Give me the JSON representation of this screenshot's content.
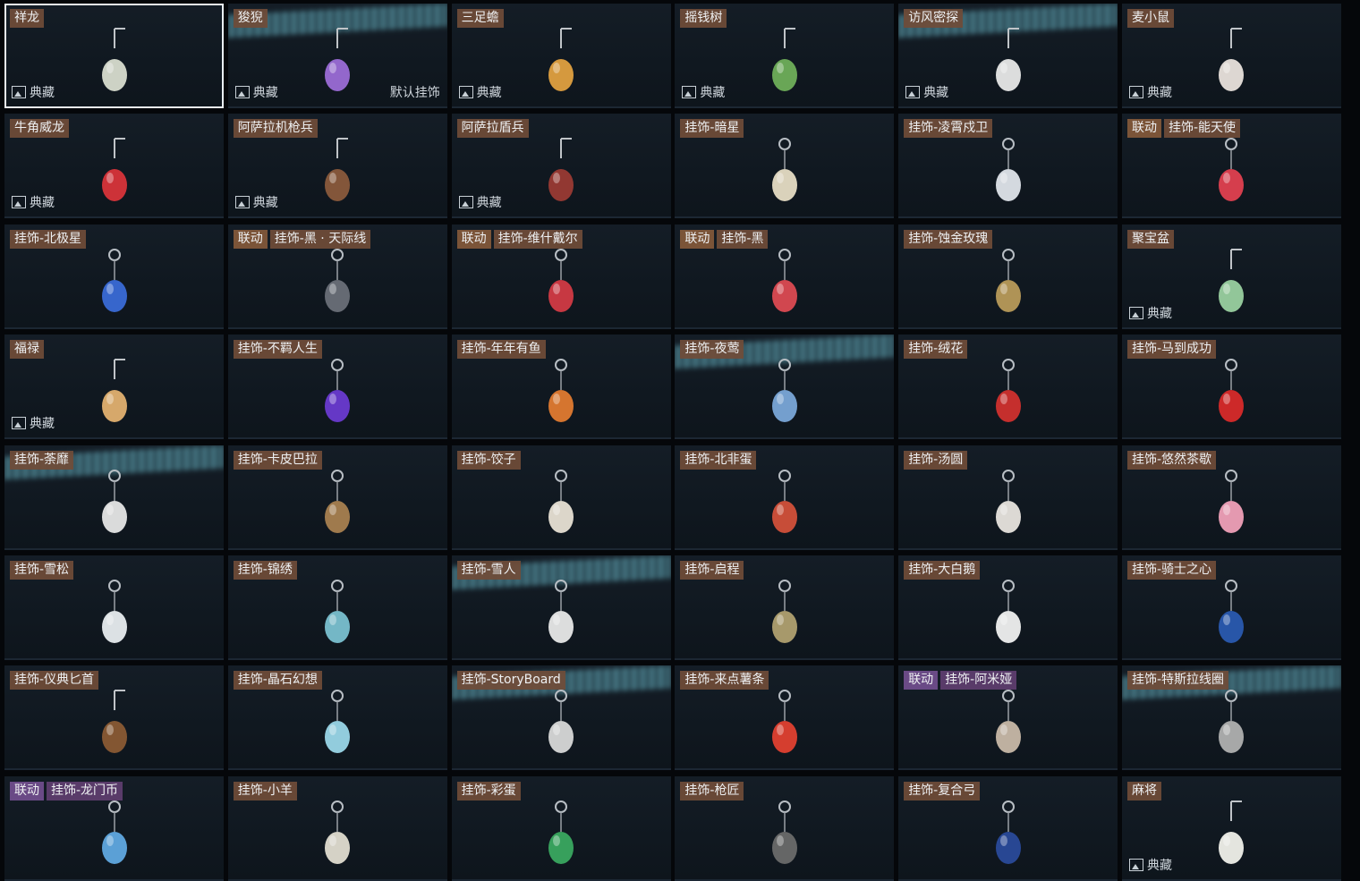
{
  "labels": {
    "collection": "典藏",
    "default_charm": "默认挂饰",
    "collab": "联动"
  },
  "tiles": [
    {
      "name": "祥龙",
      "collection": true,
      "selected": true,
      "color": "#d8dccf",
      "ring": false
    },
    {
      "name": "狻猊",
      "collection": true,
      "default": true,
      "glare": true,
      "color": "#9b6bd6",
      "ring": false
    },
    {
      "name": "三足蟾",
      "collection": true,
      "color": "#e0a040",
      "ring": false
    },
    {
      "name": "摇钱树",
      "collection": true,
      "color": "#6fae5a",
      "ring": false
    },
    {
      "name": "访风密探",
      "collection": true,
      "glare": true,
      "color": "#e8e8e8",
      "ring": false
    },
    {
      "name": "麦小鼠",
      "collection": true,
      "color": "#e9e2dc",
      "ring": false
    },
    {
      "name": "牛角威龙",
      "collection": true,
      "color": "#d8343a",
      "ring": false
    },
    {
      "name": "阿萨拉机枪兵",
      "collection": true,
      "color": "#8a5a3c",
      "ring": false
    },
    {
      "name": "阿萨拉盾兵",
      "collection": true,
      "color": "#9a3a34",
      "ring": false
    },
    {
      "name": "挂饰-暗星",
      "color": "#e6dcc4",
      "ring": true
    },
    {
      "name": "挂饰-凌霄戍卫",
      "color": "#dfe4ea",
      "ring": true
    },
    {
      "name": "挂饰-能天使",
      "collab": "联动",
      "collabStyle": "brown",
      "color": "#e04050",
      "ring": true
    },
    {
      "name": "挂饰-北极星",
      "color": "#3a6ad6",
      "ring": true
    },
    {
      "name": "挂饰-黑 · 天际线",
      "collab": "联动",
      "collabStyle": "brown",
      "color": "#6a6f78",
      "ring": true
    },
    {
      "name": "挂饰-维什戴尔",
      "collab": "联动",
      "collabStyle": "brown",
      "color": "#d23a44",
      "ring": true
    },
    {
      "name": "挂饰-黑",
      "collab": "联动",
      "collabStyle": "brown",
      "color": "#dc4a52",
      "ring": true
    },
    {
      "name": "挂饰-蚀金玫瑰",
      "color": "#b89a5a",
      "ring": true
    },
    {
      "name": "聚宝盆",
      "collection": true,
      "color": "#9ad0a0",
      "ring": false
    },
    {
      "name": "福禄",
      "collection": true,
      "color": "#e2b070",
      "ring": false
    },
    {
      "name": "挂饰-不羁人生",
      "color": "#6a3ad0",
      "ring": true
    },
    {
      "name": "挂饰-年年有鱼",
      "color": "#e07a30",
      "ring": true
    },
    {
      "name": "挂饰-夜莺",
      "glare": true,
      "color": "#7aa6d8",
      "ring": true
    },
    {
      "name": "挂饰-绒花",
      "color": "#d0302e",
      "ring": true
    },
    {
      "name": "挂饰-马到成功",
      "color": "#d82a2a",
      "ring": true
    },
    {
      "name": "挂饰-荼靡",
      "glare": true,
      "color": "#e6e6e6",
      "ring": true
    },
    {
      "name": "挂饰-卡皮巴拉",
      "color": "#a88050",
      "ring": true
    },
    {
      "name": "挂饰-饺子",
      "color": "#e8e0d4",
      "ring": true
    },
    {
      "name": "挂饰-北非蛋",
      "color": "#d2503a",
      "ring": true
    },
    {
      "name": "挂饰-汤圆",
      "color": "#e8e4de",
      "ring": true
    },
    {
      "name": "挂饰-悠然茶歇",
      "color": "#f0a0b8",
      "ring": true
    },
    {
      "name": "挂饰-雪松",
      "color": "#e8ecef",
      "ring": true
    },
    {
      "name": "挂饰-锦绣",
      "color": "#7ac0d0",
      "ring": true
    },
    {
      "name": "挂饰-雪人",
      "glare": true,
      "color": "#e8e8e8",
      "ring": true
    },
    {
      "name": "挂饰-启程",
      "color": "#b0a070",
      "ring": true
    },
    {
      "name": "挂饰-大白鹅",
      "color": "#f0f0f0",
      "ring": true
    },
    {
      "name": "挂饰-骑士之心",
      "color": "#2a5ab0",
      "ring": true
    },
    {
      "name": "挂饰-仪典匕首",
      "color": "#8a5a34",
      "ring": false
    },
    {
      "name": "挂饰-晶石幻想",
      "color": "#9ad6e8",
      "ring": true
    },
    {
      "name": "挂饰-StoryBoard",
      "glare": true,
      "color": "#d8d8d8",
      "ring": true
    },
    {
      "name": "挂饰-来点薯条",
      "color": "#e04030",
      "ring": true
    },
    {
      "name": "挂饰-阿米娅",
      "collab": "联动",
      "collabStyle": "purple",
      "color": "#c8b8a8",
      "ring": true
    },
    {
      "name": "挂饰-特斯拉线圈",
      "glare": true,
      "color": "#b0b0b0",
      "ring": true
    },
    {
      "name": "挂饰-龙门币",
      "collab": "联动",
      "collabStyle": "purple",
      "color": "#60a8e0",
      "ring": true
    },
    {
      "name": "挂饰-小羊",
      "color": "#e0dcd0",
      "ring": true
    },
    {
      "name": "挂饰-彩蛋",
      "color": "#3aa860",
      "ring": true
    },
    {
      "name": "挂饰-枪匠",
      "color": "#6a6a6a",
      "ring": true
    },
    {
      "name": "挂饰-复合弓",
      "color": "#2a4a9a",
      "ring": true
    },
    {
      "name": "麻将",
      "collection": true,
      "color": "#f0f0ea",
      "ring": false
    }
  ]
}
